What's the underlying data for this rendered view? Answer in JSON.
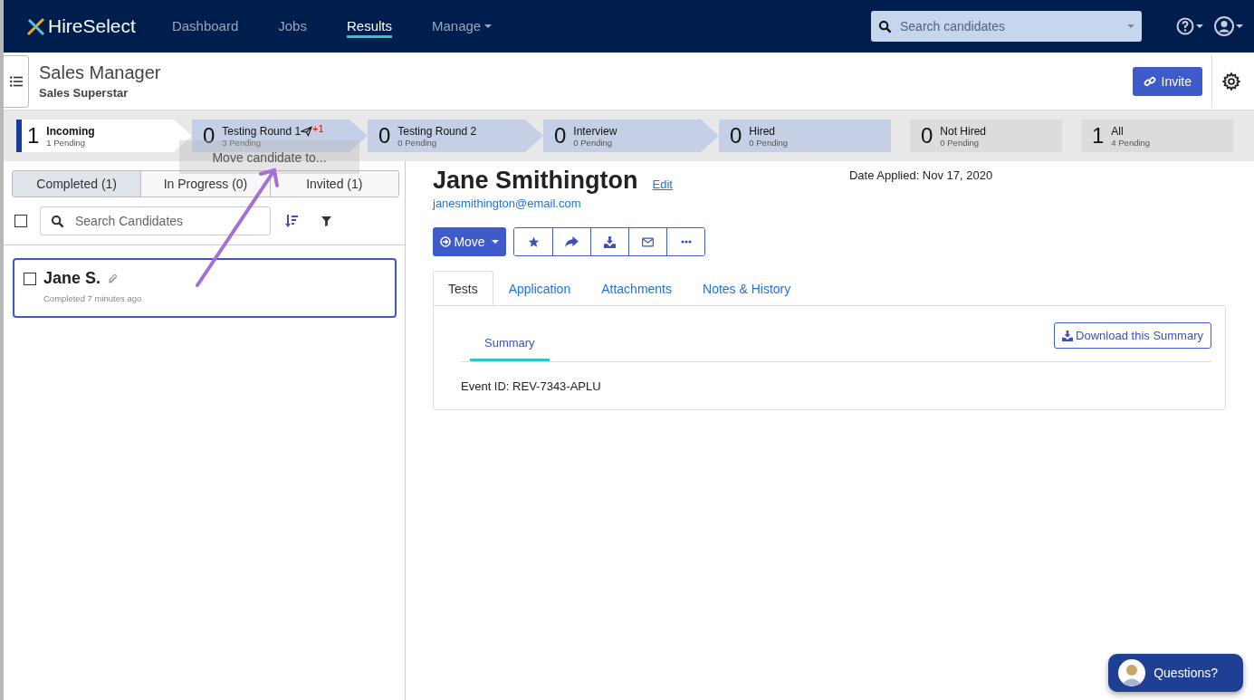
{
  "navbar": {
    "brand": "HireSelect",
    "links": [
      {
        "label": "Dashboard",
        "selected": false,
        "dropdown": false
      },
      {
        "label": "Jobs",
        "selected": false,
        "dropdown": false
      },
      {
        "label": "Results",
        "selected": true,
        "dropdown": false
      },
      {
        "label": "Manage",
        "selected": false,
        "dropdown": true
      }
    ],
    "search": {
      "placeholder": "Search candidates"
    }
  },
  "header": {
    "title": "Sales Manager",
    "subtitle": "Sales Superstar",
    "invite_button": "Invite"
  },
  "stages": [
    {
      "kind": "step",
      "count": "1",
      "label": "Incoming",
      "pending": "1 Pending",
      "selected": true
    },
    {
      "kind": "step",
      "count": "0",
      "label": "Testing Round 1",
      "pending": "3 Pending",
      "selected": false,
      "badge": "+1"
    },
    {
      "kind": "step",
      "count": "0",
      "label": "Testing Round 2",
      "pending": "0 Pending",
      "selected": false
    },
    {
      "kind": "step",
      "count": "0",
      "label": "Interview",
      "pending": "0 Pending",
      "selected": false
    },
    {
      "kind": "final",
      "count": "0",
      "label": "Hired",
      "pending": "0 Pending",
      "selected": false
    },
    {
      "kind": "outcome",
      "count": "0",
      "label": "Not Hired",
      "pending": "0 Pending",
      "selected": false
    },
    {
      "kind": "outcome",
      "count": "1",
      "label": "All",
      "pending": "4 Pending",
      "selected": false
    }
  ],
  "drag_ghost": {
    "label": "Move candidate to..."
  },
  "candidate_tabs": [
    {
      "label": "Completed (1)",
      "selected": true
    },
    {
      "label": "In Progress (0)",
      "selected": false
    },
    {
      "label": "Invited (1)",
      "selected": false
    }
  ],
  "candidate_search": {
    "placeholder": "Search Candidates",
    "select_all_checked": false
  },
  "candidates": [
    {
      "name": "Jane S.",
      "status": "Completed 7 minutes ago",
      "checked": false,
      "selected": true
    }
  ],
  "detail": {
    "name": "Jane Smithington",
    "edit_link": "Edit",
    "email": "janesmithington@email.com",
    "date_applied": "Date Applied: Nov 17, 2020",
    "move_button": "Move",
    "tabs": [
      {
        "label": "Tests",
        "selected": true
      },
      {
        "label": "Application",
        "selected": false
      },
      {
        "label": "Attachments",
        "selected": false
      },
      {
        "label": "Notes & History",
        "selected": false
      }
    ],
    "subtabs": [
      {
        "label": "Summary",
        "selected": true
      }
    ],
    "download_button": "Download this Summary",
    "event_id": "Event ID: REV-7343-APLU"
  },
  "chat_button": {
    "label": "Questions?"
  }
}
